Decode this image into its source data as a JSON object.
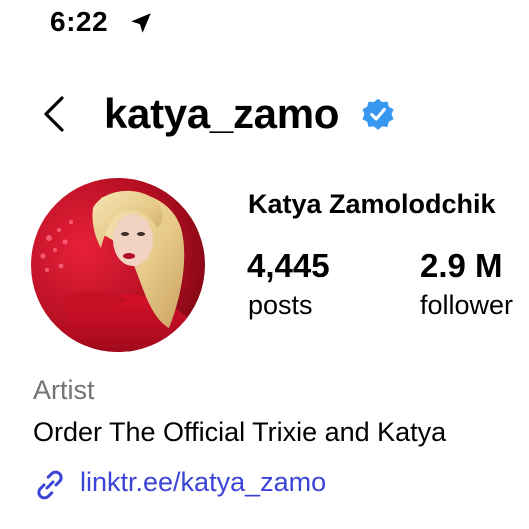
{
  "status_bar": {
    "time": "6:22",
    "location_icon": "location-arrow-icon"
  },
  "header": {
    "back_icon": "chevron-left-icon",
    "username": "katya_zamo",
    "verified_icon": "verified-badge-icon",
    "verified_color": "#3897f0"
  },
  "profile": {
    "full_name": "Katya Zamolodchik",
    "stats": {
      "posts_count": "4,445",
      "posts_label": "posts",
      "followers_count": "2.9 M",
      "followers_label": "follower"
    },
    "category": "Artist",
    "bio": "Order The Official Trixie and Katya",
    "link": "linktr.ee/katya_zamo",
    "link_icon": "link-icon",
    "link_color": "#3b44d6"
  }
}
